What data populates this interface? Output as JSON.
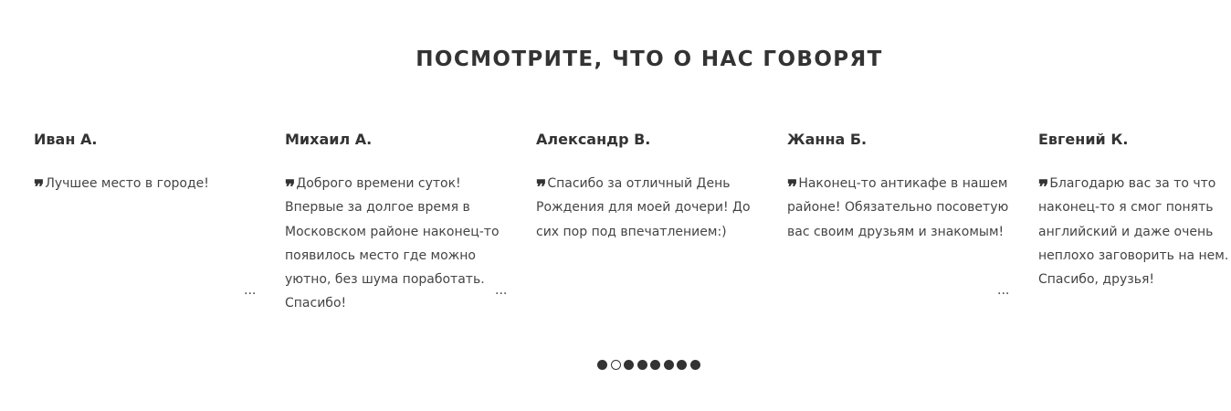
{
  "section": {
    "title": "ПОСМОТРИТЕ, ЧТО О НАС ГОВОРЯТ"
  },
  "reviews": [
    {
      "author": "Иван А.",
      "text": "Лучшее место в городе!",
      "more": "..."
    },
    {
      "author": "Михаил А.",
      "text": "Доброго времени суток! Впервые за долгое время в Московском районе наконец-то появилось место где можно уютно, без шума поработать. Спасибо!",
      "more": "..."
    },
    {
      "author": "Александр В.",
      "text": "Спасибо за отличный День Рождения для моей дочери! До сих пор под впечатлением:)",
      "more": ""
    },
    {
      "author": "Жанна Б.",
      "text": "Наконец-то антикафе в нашем районе! Обязательно посоветую вас своим друзьям и знакомым!",
      "more": "..."
    },
    {
      "author": "Евгений К.",
      "text": "Благодарю вас за то что наконец-то я смог понять английский и даже очень неплохо заговорить на нем. Спасибо, друзья!",
      "more": ""
    }
  ],
  "quote_icon": "quote-icon",
  "pager": {
    "total": 8,
    "active_index": 1
  }
}
